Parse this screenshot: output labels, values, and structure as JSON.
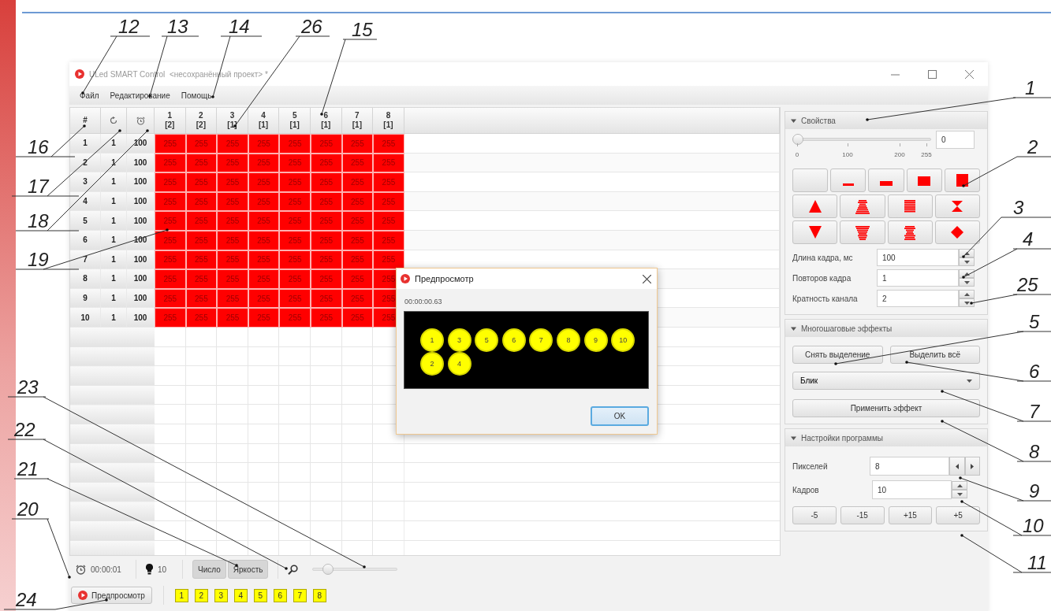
{
  "title_bar": {
    "title": "ULed SMART Control  <несохранённый проект> *"
  },
  "menu": [
    "Файл",
    "Редактирование",
    "Помощь"
  ],
  "grid": {
    "index_header": "#",
    "channels": [
      {
        "number": "1",
        "multiplicity": "[2]"
      },
      {
        "number": "2",
        "multiplicity": "[2]"
      },
      {
        "number": "3",
        "multiplicity": "[1]"
      },
      {
        "number": "4",
        "multiplicity": "[1]"
      },
      {
        "number": "5",
        "multiplicity": "[1]"
      },
      {
        "number": "6",
        "multiplicity": "[1]"
      },
      {
        "number": "7",
        "multiplicity": "[1]"
      },
      {
        "number": "8",
        "multiplicity": "[1]"
      }
    ],
    "rows": [
      {
        "index": "1",
        "repeats": "1",
        "duration": "100",
        "values": [
          "255",
          "255",
          "255",
          "255",
          "255",
          "255",
          "255",
          "255"
        ]
      },
      {
        "index": "2",
        "repeats": "1",
        "duration": "100",
        "values": [
          "255",
          "255",
          "255",
          "255",
          "255",
          "255",
          "255",
          "255"
        ]
      },
      {
        "index": "3",
        "repeats": "1",
        "duration": "100",
        "values": [
          "255",
          "255",
          "255",
          "255",
          "255",
          "255",
          "255",
          "255"
        ]
      },
      {
        "index": "4",
        "repeats": "1",
        "duration": "100",
        "values": [
          "255",
          "255",
          "255",
          "255",
          "255",
          "255",
          "255",
          "255"
        ]
      },
      {
        "index": "5",
        "repeats": "1",
        "duration": "100",
        "values": [
          "255",
          "255",
          "255",
          "255",
          "255",
          "255",
          "255",
          "255"
        ]
      },
      {
        "index": "6",
        "repeats": "1",
        "duration": "100",
        "values": [
          "255",
          "255",
          "255",
          "255",
          "255",
          "255",
          "255",
          "255"
        ]
      },
      {
        "index": "7",
        "repeats": "1",
        "duration": "100",
        "values": [
          "255",
          "255",
          "255",
          "255",
          "255",
          "255",
          "255",
          "255"
        ]
      },
      {
        "index": "8",
        "repeats": "1",
        "duration": "100",
        "values": [
          "255",
          "255",
          "255",
          "255",
          "255",
          "255",
          "255",
          "255"
        ]
      },
      {
        "index": "9",
        "repeats": "1",
        "duration": "100",
        "values": [
          "255",
          "255",
          "255",
          "255",
          "255",
          "255",
          "255",
          "255"
        ]
      },
      {
        "index": "10",
        "repeats": "1",
        "duration": "100",
        "values": [
          "255",
          "255",
          "255",
          "255",
          "255",
          "255",
          "255",
          "255"
        ]
      }
    ]
  },
  "status": {
    "time": "00:00:01",
    "led_count": "10"
  },
  "view_toggles": [
    {
      "label": "Число",
      "selected": true
    },
    {
      "label": "Яркость",
      "selected": true
    }
  ],
  "zoom_slider": {
    "level": 0.13
  },
  "preview_button": {
    "label": "Предпросмотр"
  },
  "channel_chips": [
    "1",
    "2",
    "3",
    "4",
    "5",
    "6",
    "7",
    "8"
  ],
  "properties": {
    "title": "Свойства",
    "expanded": true,
    "slider": {
      "level": 0,
      "ticks": [
        "0",
        "100",
        "200",
        "255"
      ]
    },
    "value": "0",
    "fields": [
      {
        "label": "Длина кадра, мс",
        "value": "100"
      },
      {
        "label": "Повторов кадра",
        "value": "1"
      },
      {
        "label": "Кратность канала",
        "value": "2"
      }
    ]
  },
  "effects": {
    "title": "Многошаговые эффекты",
    "expanded": true,
    "buttons": [
      "Снять выделение",
      "Выделить всё"
    ],
    "effect_select": {
      "value": "Блик"
    },
    "apply_button": "Применить эффект"
  },
  "program_settings": {
    "title": "Настройки программы",
    "expanded": true,
    "fields": [
      {
        "label": "Пикселей",
        "value": "8",
        "kind": "stepper"
      },
      {
        "label": "Кадров",
        "value": "10",
        "kind": "spinner"
      }
    ],
    "buttons": [
      "-5",
      "-15",
      "+15",
      "+5"
    ]
  },
  "preview_dialog": {
    "title": "Предпросмотр",
    "time": "00:00:00.63",
    "leds": [
      "1",
      "3",
      "5",
      "6",
      "7",
      "8",
      "9",
      "10",
      "2",
      "4"
    ],
    "ok_button": "OK"
  },
  "callouts": [
    "12",
    "13",
    "14",
    "26",
    "15",
    "16",
    "17",
    "18",
    "19",
    "23",
    "22",
    "21",
    "20",
    "24",
    "1",
    "2",
    "3",
    "4",
    "25",
    "5",
    "6",
    "7",
    "8",
    "9",
    "10",
    "11"
  ]
}
